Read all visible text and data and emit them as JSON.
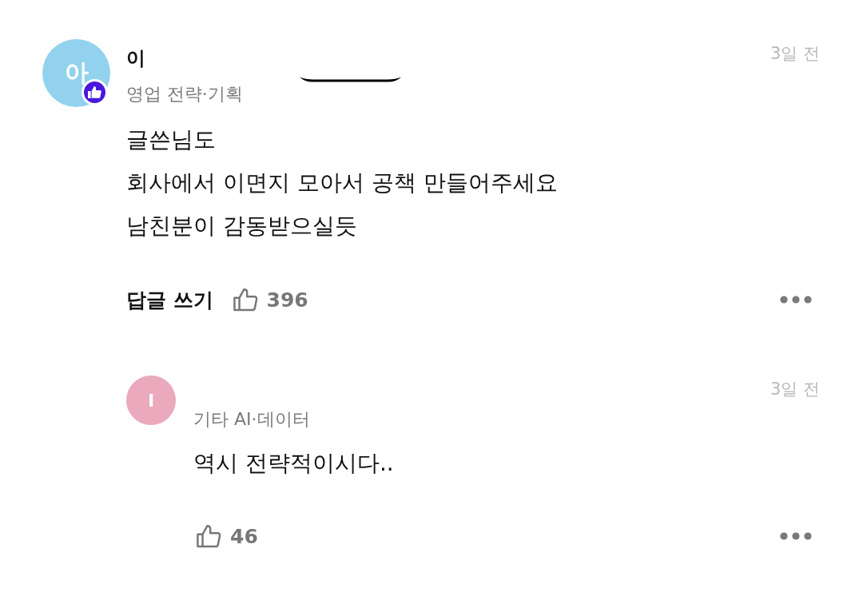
{
  "comments": [
    {
      "avatar": {
        "initial": "아",
        "color": "#93d2ee",
        "badge": true
      },
      "author": "이",
      "redaction": true,
      "job": "영업 전략·기획",
      "time": "3일 전",
      "body": [
        "글쓴님도",
        "회사에서 이면지 모아서 공책 만들어주세요",
        "남친분이 감동받으실듯"
      ],
      "reply_button": "답글 쓰기",
      "likes": "396",
      "replies": [
        {
          "avatar": {
            "initial": "I",
            "color": "#eaa9bd",
            "badge": false
          },
          "job": "기타 AI·데이터",
          "time": "3일 전",
          "body": [
            "역시 전략적이시다.."
          ],
          "likes": "46"
        }
      ]
    }
  ]
}
